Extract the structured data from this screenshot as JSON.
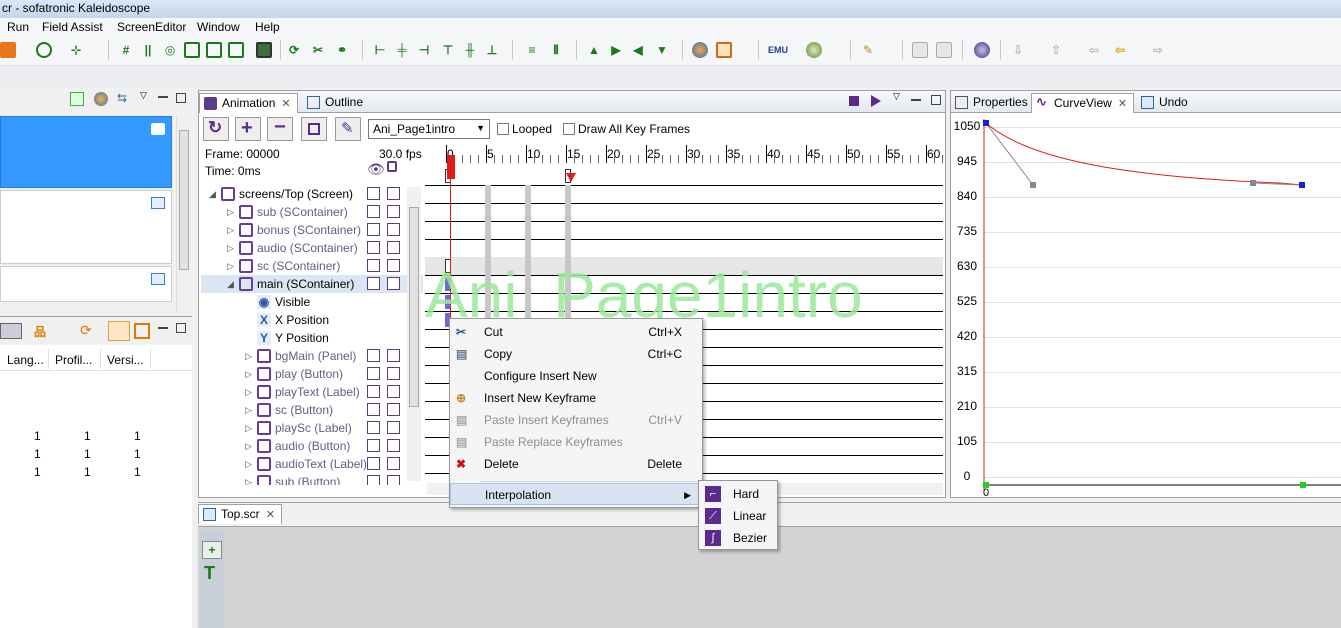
{
  "app": {
    "title": "cr - sofatronic Kaleidoscope"
  },
  "menu": [
    "Run",
    "Field Assist",
    "ScreenEditor",
    "Window",
    "Help"
  ],
  "left_panel": {
    "columns": [
      "Lang...",
      "Profil...",
      "Versi..."
    ],
    "rows": [
      [
        "1",
        "1",
        "1"
      ],
      [
        "1",
        "1",
        "1"
      ],
      [
        "1",
        "1",
        "1"
      ]
    ]
  },
  "animation": {
    "tabs": [
      "Animation",
      "Outline"
    ],
    "dropdown": "Ani_Page1intro",
    "looped": "Looped",
    "draw_all": "Draw All Key Frames",
    "frame": "Frame: 00000",
    "time": "Time:  0ms",
    "fps": "30.0 fps",
    "watermark": "Ani_Page1intro",
    "ticks": [
      "0",
      "5",
      "10",
      "15",
      "20",
      "25",
      "30",
      "35",
      "40",
      "45",
      "50",
      "55",
      "60"
    ],
    "tree": [
      {
        "label": "screens/Top (Screen)",
        "indent": 0,
        "expand": "open",
        "color": "#000"
      },
      {
        "label": "sub (SContainer)",
        "indent": 1,
        "expand": "closed",
        "color": "#6b5a7e"
      },
      {
        "label": "bonus (SContainer)",
        "indent": 1,
        "expand": "closed",
        "color": "#6b5a7e"
      },
      {
        "label": "audio (SContainer)",
        "indent": 1,
        "expand": "closed",
        "color": "#6b5a7e"
      },
      {
        "label": "sc (SContainer)",
        "indent": 1,
        "expand": "closed",
        "color": "#6b5a7e"
      },
      {
        "label": "main (SContainer)",
        "indent": 1,
        "expand": "open",
        "color": "#000"
      },
      {
        "label": "Visible",
        "indent": 2,
        "expand": "",
        "color": "#000"
      },
      {
        "label": "X Position",
        "indent": 2,
        "expand": "",
        "color": "#000"
      },
      {
        "label": "Y Position",
        "indent": 2,
        "expand": "",
        "color": "#000"
      },
      {
        "label": "bgMain (Panel)",
        "indent": 2,
        "expand": "closed",
        "color": "#6b5a7e"
      },
      {
        "label": "play (Button)",
        "indent": 2,
        "expand": "closed",
        "color": "#6b5a7e"
      },
      {
        "label": "playText (Label)",
        "indent": 2,
        "expand": "closed",
        "color": "#6b5a7e"
      },
      {
        "label": "sc (Button)",
        "indent": 2,
        "expand": "closed",
        "color": "#6b5a7e"
      },
      {
        "label": "playSc (Label)",
        "indent": 2,
        "expand": "closed",
        "color": "#6b5a7e"
      },
      {
        "label": "audio (Button)",
        "indent": 2,
        "expand": "closed",
        "color": "#6b5a7e"
      },
      {
        "label": "audioText (Label)",
        "indent": 2,
        "expand": "closed",
        "color": "#6b5a7e"
      },
      {
        "label": "sub (Button)",
        "indent": 2,
        "expand": "closed",
        "color": "#6b5a7e"
      }
    ]
  },
  "context_menu": {
    "items": [
      {
        "label": "Cut",
        "shortcut": "Ctrl+X",
        "disabled": false
      },
      {
        "label": "Copy",
        "shortcut": "Ctrl+C",
        "disabled": false
      },
      {
        "label": "Configure Insert New",
        "shortcut": "",
        "disabled": false
      },
      {
        "label": "Insert New Keyframe",
        "shortcut": "",
        "disabled": false
      },
      {
        "label": "Paste Insert Keyframes",
        "shortcut": "Ctrl+V",
        "disabled": true
      },
      {
        "label": "Paste Replace Keyframes",
        "shortcut": "",
        "disabled": true
      },
      {
        "label": "Delete",
        "shortcut": "Delete",
        "disabled": false
      }
    ],
    "interpolation": "Interpolation",
    "submenu": [
      "Hard",
      "Linear",
      "Bezier"
    ]
  },
  "right": {
    "tabs": [
      "Properties",
      "CurveView",
      "Undo"
    ],
    "y_labels": [
      "1050",
      "945",
      "840",
      "735",
      "630",
      "525",
      "420",
      "315",
      "210",
      "105",
      "0"
    ],
    "x_label": "0"
  },
  "editor": {
    "tab": "Top.scr"
  }
}
